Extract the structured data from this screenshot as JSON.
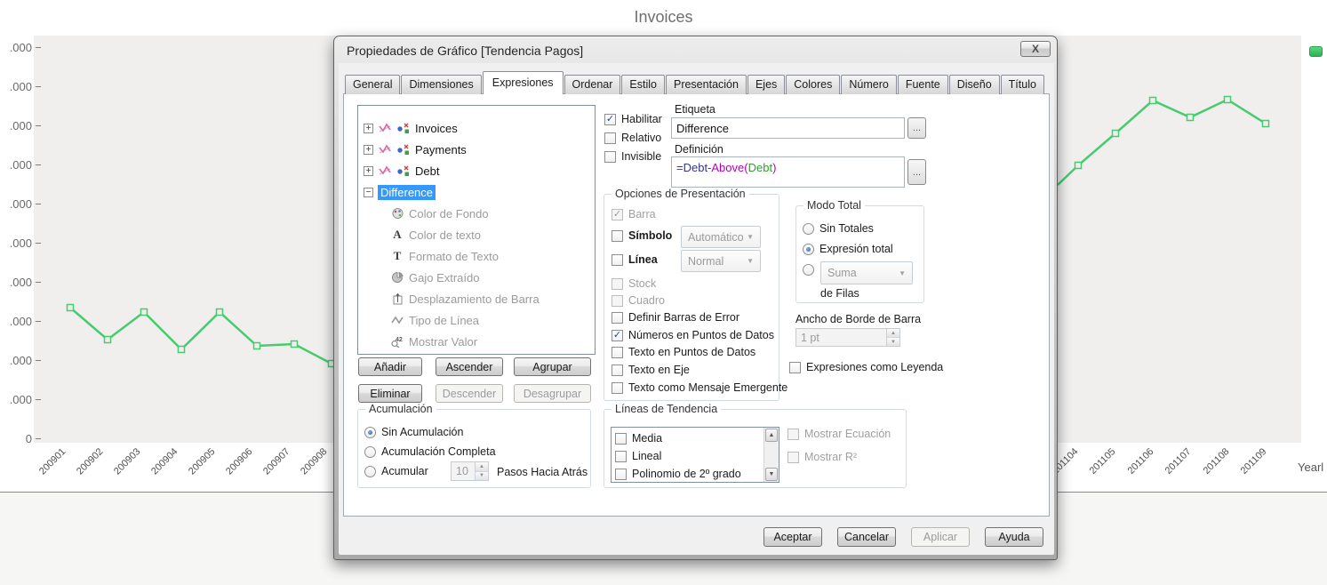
{
  "glyphs": {
    "check": "✓",
    "dd_arrow": "▼",
    "spin_up": "▲",
    "spin_down": "▼",
    "scroll_up": "▲",
    "scroll_down": "▼",
    "plus": "+",
    "minus": "−",
    "close": "X",
    "mostrar_valor_num": "42"
  },
  "colors": {
    "series_green": "#47cb6e",
    "selection_blue": "#3399ff",
    "plot_bg": "#f0efee"
  },
  "page": {
    "chart_title": "Invoices",
    "axis_title": "Yearl",
    "y_labels": [
      ".000",
      ".000",
      ".000",
      ".000",
      ".000",
      ".000",
      ".000",
      ".000",
      ".000",
      ".000",
      "0"
    ],
    "x_labels_left": [
      "200901",
      "200902",
      "200903",
      "200904",
      "200905",
      "200906",
      "200907",
      "200908"
    ],
    "x_labels_right": [
      "201104",
      "201105",
      "201106",
      "201107",
      "201108",
      "201109"
    ]
  },
  "chart_data": {
    "type": "line",
    "title": "Invoices",
    "x_visible_left": [
      "200901",
      "200902",
      "200903",
      "200904",
      "200905",
      "200906",
      "200907",
      "200908"
    ],
    "x_visible_right": [
      "201104",
      "201105",
      "201106",
      "201107",
      "201108",
      "201109"
    ],
    "note": "y-axis labels truncated at screen edge (.000); one green series with square markers, middle occluded by dialog",
    "series": [
      {
        "name": "green-series",
        "color": "#47cb6e"
      }
    ]
  },
  "dialog": {
    "title": "Propiedades de Gráfico [Tendencia Pagos]",
    "tabs": [
      "General",
      "Dimensiones",
      "Expresiones",
      "Ordenar",
      "Estilo",
      "Presentación",
      "Ejes",
      "Colores",
      "Número",
      "Fuente",
      "Diseño",
      "Título"
    ],
    "active_tab": "Expresiones",
    "tree": {
      "items": [
        "Invoices",
        "Payments",
        "Debt",
        "Difference"
      ],
      "selected": "Difference",
      "children": [
        "Color de Fondo",
        "Color de texto",
        "Formato de Texto",
        "Gajo Extraído",
        "Desplazamiento de Barra",
        "Tipo de Línea",
        "Mostrar Valor"
      ]
    },
    "flags": {
      "habilitar": "Habilitar",
      "relativo": "Relativo",
      "invisible": "Invisible"
    },
    "etiqueta": {
      "label": "Etiqueta",
      "value": "Difference",
      "browse": "..."
    },
    "definicion": {
      "label": "Definición",
      "expr1": "=Debt-",
      "expr2": "Above(",
      "expr3": "Debt",
      "expr4": ")",
      "browse": "..."
    },
    "presentacion": {
      "title": "Opciones de Presentación",
      "barra": "Barra",
      "simbolo": "Símbolo",
      "linea": "Línea",
      "stock": "Stock",
      "cuadro": "Cuadro",
      "definir_barras": "Definir Barras de Error",
      "numeros": "Números en Puntos de Datos",
      "texto_puntos": "Texto en Puntos de Datos",
      "texto_eje": "Texto en Eje",
      "texto_mensaje": "Texto como Mensaje Emergente",
      "simbolo_value": "Automático",
      "linea_value": "Normal"
    },
    "modo_total": {
      "title": "Modo Total",
      "sin_totales": "Sin Totales",
      "expresion_total": "Expresión total",
      "suma": "Suma",
      "de_filas": "de Filas"
    },
    "ancho_borde": {
      "label": "Ancho de Borde de Barra",
      "value": "1 pt"
    },
    "leyenda_checkbox": "Expresiones como Leyenda",
    "buttons": {
      "anadir": "Añadir",
      "ascender": "Ascender",
      "agrupar": "Agrupar",
      "eliminar": "Eliminar",
      "descender": "Descender",
      "desagrupar": "Desagrupar"
    },
    "acumulacion": {
      "title": "Acumulación",
      "sin": "Sin Acumulación",
      "completa": "Acumulación Completa",
      "acumular": "Acumular",
      "steps": "10",
      "steps_label": "Pasos Hacia Atrás"
    },
    "tendencia": {
      "title": "Líneas de Tendencia",
      "items": [
        "Media",
        "Lineal",
        "Polinomio de 2º grado"
      ],
      "mostrar_ecuacion": "Mostrar Ecuación",
      "mostrar_r2": "Mostrar R²"
    },
    "footer": {
      "aceptar": "Aceptar",
      "cancelar": "Cancelar",
      "aplicar": "Aplicar",
      "ayuda": "Ayuda"
    }
  }
}
